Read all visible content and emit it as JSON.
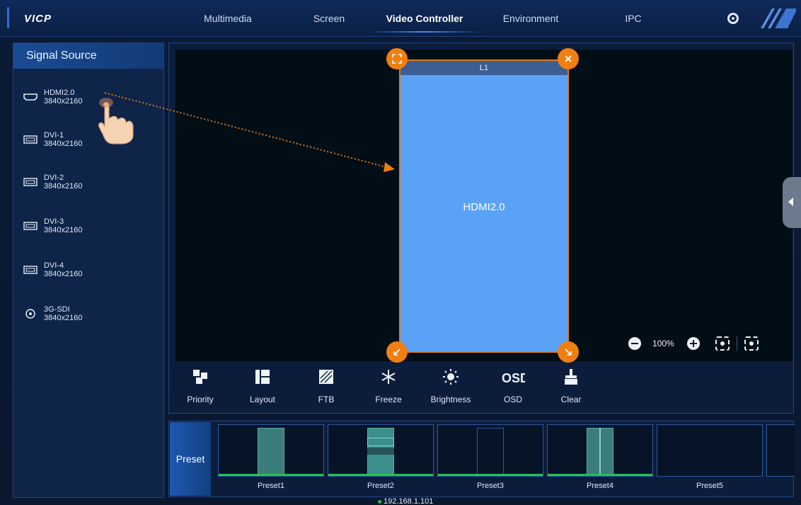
{
  "app": {
    "brand": "VICP"
  },
  "nav": {
    "items": [
      {
        "label": "Multimedia"
      },
      {
        "label": "Screen"
      },
      {
        "label": "Video Controller"
      },
      {
        "label": "Environment"
      },
      {
        "label": "IPC"
      }
    ],
    "active_index": 2
  },
  "signal_source": {
    "title": "Signal Source",
    "items": [
      {
        "name": "HDMI2.0",
        "res": "3840x2160",
        "icon": "hdmi-icon"
      },
      {
        "name": "DVI-1",
        "res": "3840x2160",
        "icon": "dvi-icon"
      },
      {
        "name": "DVI-2",
        "res": "3840x2160",
        "icon": "dvi-icon"
      },
      {
        "name": "DVI-3",
        "res": "3840x2160",
        "icon": "dvi-icon"
      },
      {
        "name": "DVI-4",
        "res": "3840x2160",
        "icon": "dvi-icon"
      },
      {
        "name": "3G-SDI",
        "res": "3840x2160",
        "icon": "sdi-icon"
      }
    ]
  },
  "canvas": {
    "layer": {
      "title": "L1",
      "source": "HDMI2.0",
      "fill": "#5aa2f7",
      "border": "#e07b1d"
    },
    "zoom": "100%"
  },
  "tools": [
    {
      "label": "Priority",
      "icon": "priority-icon"
    },
    {
      "label": "Layout",
      "icon": "layout-icon"
    },
    {
      "label": "FTB",
      "icon": "ftb-icon"
    },
    {
      "label": "Freeze",
      "icon": "snowflake-icon"
    },
    {
      "label": "Brightness",
      "icon": "sun-icon"
    },
    {
      "label": "OSD",
      "icon": "osd-icon"
    },
    {
      "label": "Clear",
      "icon": "broom-icon"
    }
  ],
  "presets": {
    "tag": "Preset",
    "items": [
      {
        "label": "Preset1",
        "active": true
      },
      {
        "label": "Preset2",
        "active": true
      },
      {
        "label": "Preset3",
        "active": true
      },
      {
        "label": "Preset4",
        "active": true
      },
      {
        "label": "Preset5",
        "active": false
      }
    ]
  },
  "status": {
    "ip": "192.168.1.101"
  },
  "colors": {
    "accent": "#2c6dd6",
    "handle": "#f07f11",
    "active_green": "#27c14a"
  }
}
